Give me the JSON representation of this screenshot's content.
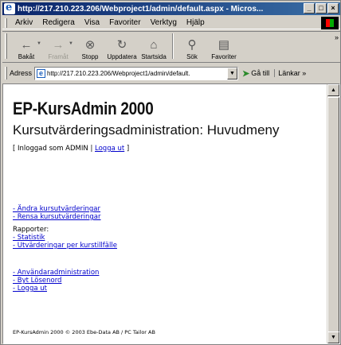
{
  "window": {
    "title": "http://217.210.223.206/Webproject1/admin/default.aspx - Micros...",
    "controls": [
      "_",
      "□",
      "×"
    ]
  },
  "menu": [
    "Arkiv",
    "Redigera",
    "Visa",
    "Favoriter",
    "Verktyg",
    "Hjälp"
  ],
  "toolbar": {
    "back": "Bakåt",
    "forward": "Framåt",
    "stop": "Stopp",
    "refresh": "Uppdatera",
    "home": "Startsida",
    "search": "Sök",
    "favorites": "Favoriter",
    "more": "»"
  },
  "address": {
    "label": "Adress",
    "url": "http://217.210.223.206/Webproject1/admin/default.",
    "go": "Gå till",
    "links": "Länkar »"
  },
  "page": {
    "heading": "EP-KursAdmin 2000",
    "subheading": "Kursutvärderingsadministration: Huvudmeny",
    "login_prefix": "[ Inloggad som ADMIN | ",
    "logout_link": "Logga ut",
    "login_suffix": " ]",
    "links_group1": [
      "- Ändra kursutvärderingar",
      "- Rensa kursutvärderingar"
    ],
    "reports_label": "Rapporter:",
    "links_group2": [
      "- Statistik",
      "- Utvärderingar per kurstillfälle"
    ],
    "links_group3": [
      "- Användaradministration",
      "- Byt Lösenord",
      "- Logga ut"
    ],
    "footer": "EP-KursAdmin 2000 © 2003 Ebe-Data AB / PC Tailor AB"
  },
  "colors": {
    "link": "#0000cc",
    "titlebar_start": "#0a246a",
    "titlebar_end": "#3a6ea5",
    "chrome": "#d4d0c8"
  }
}
